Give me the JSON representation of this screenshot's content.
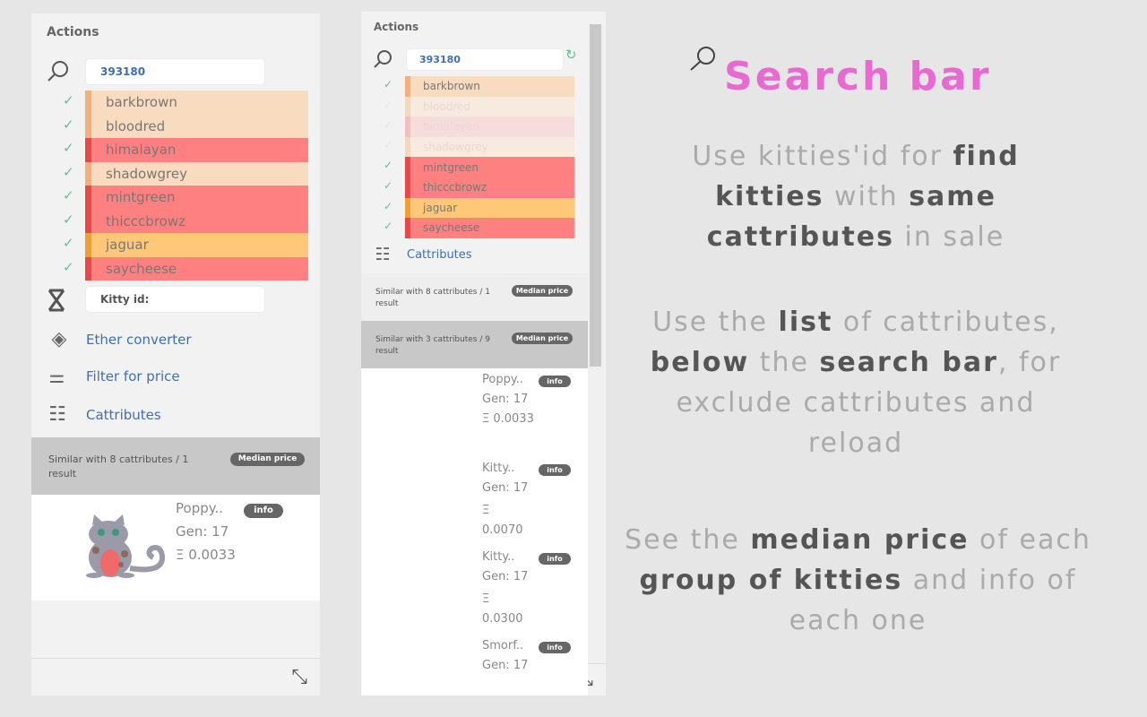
{
  "left_panel": {
    "title": "Actions",
    "search_value": "393180",
    "attributes": [
      {
        "label": "barkbrown",
        "checked": true,
        "bg": "#f9dcc0",
        "bar": "#f4b07a"
      },
      {
        "label": "bloodred",
        "checked": true,
        "bg": "#f9dcc0",
        "bar": "#f4b07a"
      },
      {
        "label": "himalayan",
        "checked": true,
        "bg": "#ff8080",
        "bar": "#e84848"
      },
      {
        "label": "shadowgrey",
        "checked": true,
        "bg": "#f9dcc0",
        "bar": "#f4b07a"
      },
      {
        "label": "mintgreen",
        "checked": true,
        "bg": "#ff8080",
        "bar": "#e84848"
      },
      {
        "label": "thicccbrowz",
        "checked": true,
        "bg": "#ff8080",
        "bar": "#e84848"
      },
      {
        "label": "jaguar",
        "checked": true,
        "bg": "#ffc878",
        "bar": "#f0a030"
      },
      {
        "label": "saycheese",
        "checked": true,
        "bg": "#ff8080",
        "bar": "#e84848"
      }
    ],
    "kitty_id_placeholder": "Kitty id:",
    "ether_converter": "Ether converter",
    "filter_price": "Filter for price",
    "cattributes": "Cattributes",
    "group": {
      "text": "Similar with 8 cattributes / 1 result",
      "badge": "Median price"
    },
    "kitty": {
      "name": "Poppy..",
      "gen": "Gen: 17",
      "price": "Ξ 0.0033",
      "info": "info",
      "color": "#9a9aa8",
      "belly": "#f06a6a"
    }
  },
  "right_panel": {
    "title": "Actions",
    "search_value": "393180",
    "attributes": [
      {
        "label": "barkbrown",
        "checked": true,
        "bg": "#f9dcc0",
        "bar": "#f4b07a"
      },
      {
        "label": "bloodred",
        "checked": false,
        "bg": "#f7ebe0",
        "bar": "#f3d8c0"
      },
      {
        "label": "himalayan",
        "checked": false,
        "bg": "#f7dcdc",
        "bar": "#f0c0c0"
      },
      {
        "label": "shadowgrey",
        "checked": false,
        "bg": "#f7ebe0",
        "bar": "#f3d8c0"
      },
      {
        "label": "mintgreen",
        "checked": true,
        "bg": "#ff8080",
        "bar": "#e84848"
      },
      {
        "label": "thicccbrowz",
        "checked": true,
        "bg": "#ff8080",
        "bar": "#e84848"
      },
      {
        "label": "jaguar",
        "checked": true,
        "bg": "#ffc878",
        "bar": "#f0a030"
      },
      {
        "label": "saycheese",
        "checked": true,
        "bg": "#ff8080",
        "bar": "#e84848"
      }
    ],
    "cattributes": "Cattributes",
    "groups": [
      {
        "text": "Similar with 8 cattributes / 1 result",
        "badge": "Median price"
      },
      {
        "text": "Similar with 3 cattributes / 9 result",
        "badge": "Median price"
      }
    ],
    "kitties": [
      {
        "name": "Poppy..",
        "gen": "Gen: 17",
        "price": "Ξ 0.0033",
        "info": "info",
        "color": "#9a9aa8",
        "belly": "#f06a6a"
      },
      {
        "name": "Kitty..",
        "gen": "Gen: 17",
        "price": "Ξ 0.0070",
        "info": "info",
        "color": "#c8b8dc",
        "belly": "#f6ead4"
      },
      {
        "name": "Kitty..",
        "gen": "Gen: 17",
        "price": "Ξ 0.0300",
        "info": "info",
        "color": "#9a9aa8",
        "belly": "#f8c898"
      },
      {
        "name": "Smorf..",
        "gen": "Gen: 17",
        "price": "",
        "info": "info",
        "color": "#9a9aa8",
        "belly": "#f8c898"
      }
    ]
  },
  "explainer": {
    "heading": "Search bar",
    "p1": [
      [
        "Use kitties'id for ",
        0
      ],
      [
        "find kitties",
        1
      ],
      [
        " with ",
        0
      ],
      [
        "same cattributes",
        1
      ],
      [
        " in sale",
        0
      ]
    ],
    "p2": [
      [
        "Use the ",
        0
      ],
      [
        "list",
        1
      ],
      [
        " of cattributes, ",
        0
      ],
      [
        "below",
        1
      ],
      [
        " the ",
        0
      ],
      [
        "search bar",
        1
      ],
      [
        ", for exclude cattributes and reload",
        0
      ]
    ],
    "p3": [
      [
        "See the ",
        0
      ],
      [
        "median price",
        1
      ],
      [
        " of each ",
        0
      ],
      [
        "group of kitties",
        1
      ],
      [
        " and info of each one",
        0
      ]
    ]
  }
}
